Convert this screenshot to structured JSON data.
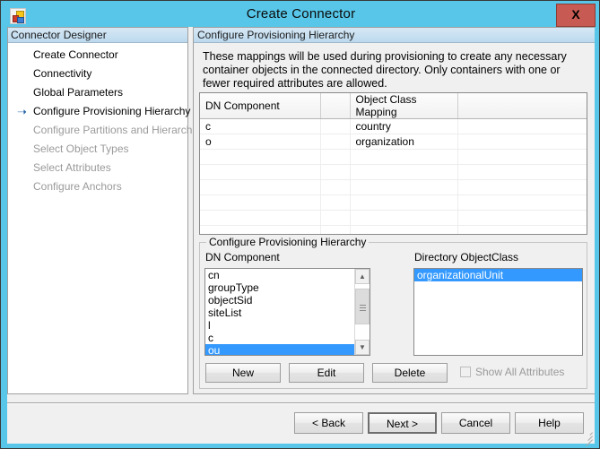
{
  "window": {
    "title": "Create Connector",
    "close_label": "X",
    "icon": "connector-squares-icon"
  },
  "sidebar": {
    "header": "Connector Designer",
    "items": [
      {
        "label": "Create Connector",
        "state": "completed",
        "current": false
      },
      {
        "label": "Connectivity",
        "state": "completed",
        "current": false
      },
      {
        "label": "Global Parameters",
        "state": "completed",
        "current": false
      },
      {
        "label": "Configure Provisioning Hierarchy",
        "state": "current",
        "current": true
      },
      {
        "label": "Configure Partitions and Hierarchies",
        "state": "disabled",
        "current": false
      },
      {
        "label": "Select Object Types",
        "state": "disabled",
        "current": false
      },
      {
        "label": "Select Attributes",
        "state": "disabled",
        "current": false
      },
      {
        "label": "Configure Anchors",
        "state": "disabled",
        "current": false
      }
    ]
  },
  "content": {
    "header": "Configure Provisioning Hierarchy",
    "intro": "These mappings will be used during provisioning to create any necessary container objects in the connected directory.  Only containers with one or fewer required attributes are allowed.",
    "grid": {
      "columns": [
        "DN Component",
        "",
        "Object Class Mapping",
        ""
      ],
      "rows": [
        {
          "dn": "c",
          "spacer": "",
          "mapping": "country",
          "trailing": ""
        },
        {
          "dn": "o",
          "spacer": "",
          "mapping": "organization",
          "trailing": ""
        }
      ],
      "empty_row_count": 7
    },
    "group": {
      "title": "Configure Provisioning Hierarchy",
      "dn_label": "DN Component",
      "objectclass_label": "Directory ObjectClass",
      "dn_items": [
        {
          "label": "cn",
          "selected": false
        },
        {
          "label": "groupType",
          "selected": false
        },
        {
          "label": "objectSid",
          "selected": false
        },
        {
          "label": "siteList",
          "selected": false
        },
        {
          "label": "l",
          "selected": false
        },
        {
          "label": "c",
          "selected": false
        },
        {
          "label": "ou",
          "selected": true
        }
      ],
      "objectclass_items": [
        {
          "label": "organizationalUnit",
          "selected": true
        }
      ],
      "buttons": {
        "new": "New",
        "edit": "Edit",
        "delete": "Delete"
      },
      "show_all_attributes": {
        "label": "Show All Attributes",
        "checked": false,
        "enabled": false
      }
    }
  },
  "footer": {
    "back": "< Back",
    "next": "Next  >",
    "cancel": "Cancel",
    "help": "Help"
  },
  "colors": {
    "window_frame": "#57c6e8",
    "close_button": "#c75b53",
    "selection": "#3399ff",
    "header_gradient_top": "#d7e8f5",
    "header_gradient_bottom": "#bcd9ee",
    "disabled_text": "#9a9a9a",
    "nav_arrow": "#1f5fa8"
  }
}
